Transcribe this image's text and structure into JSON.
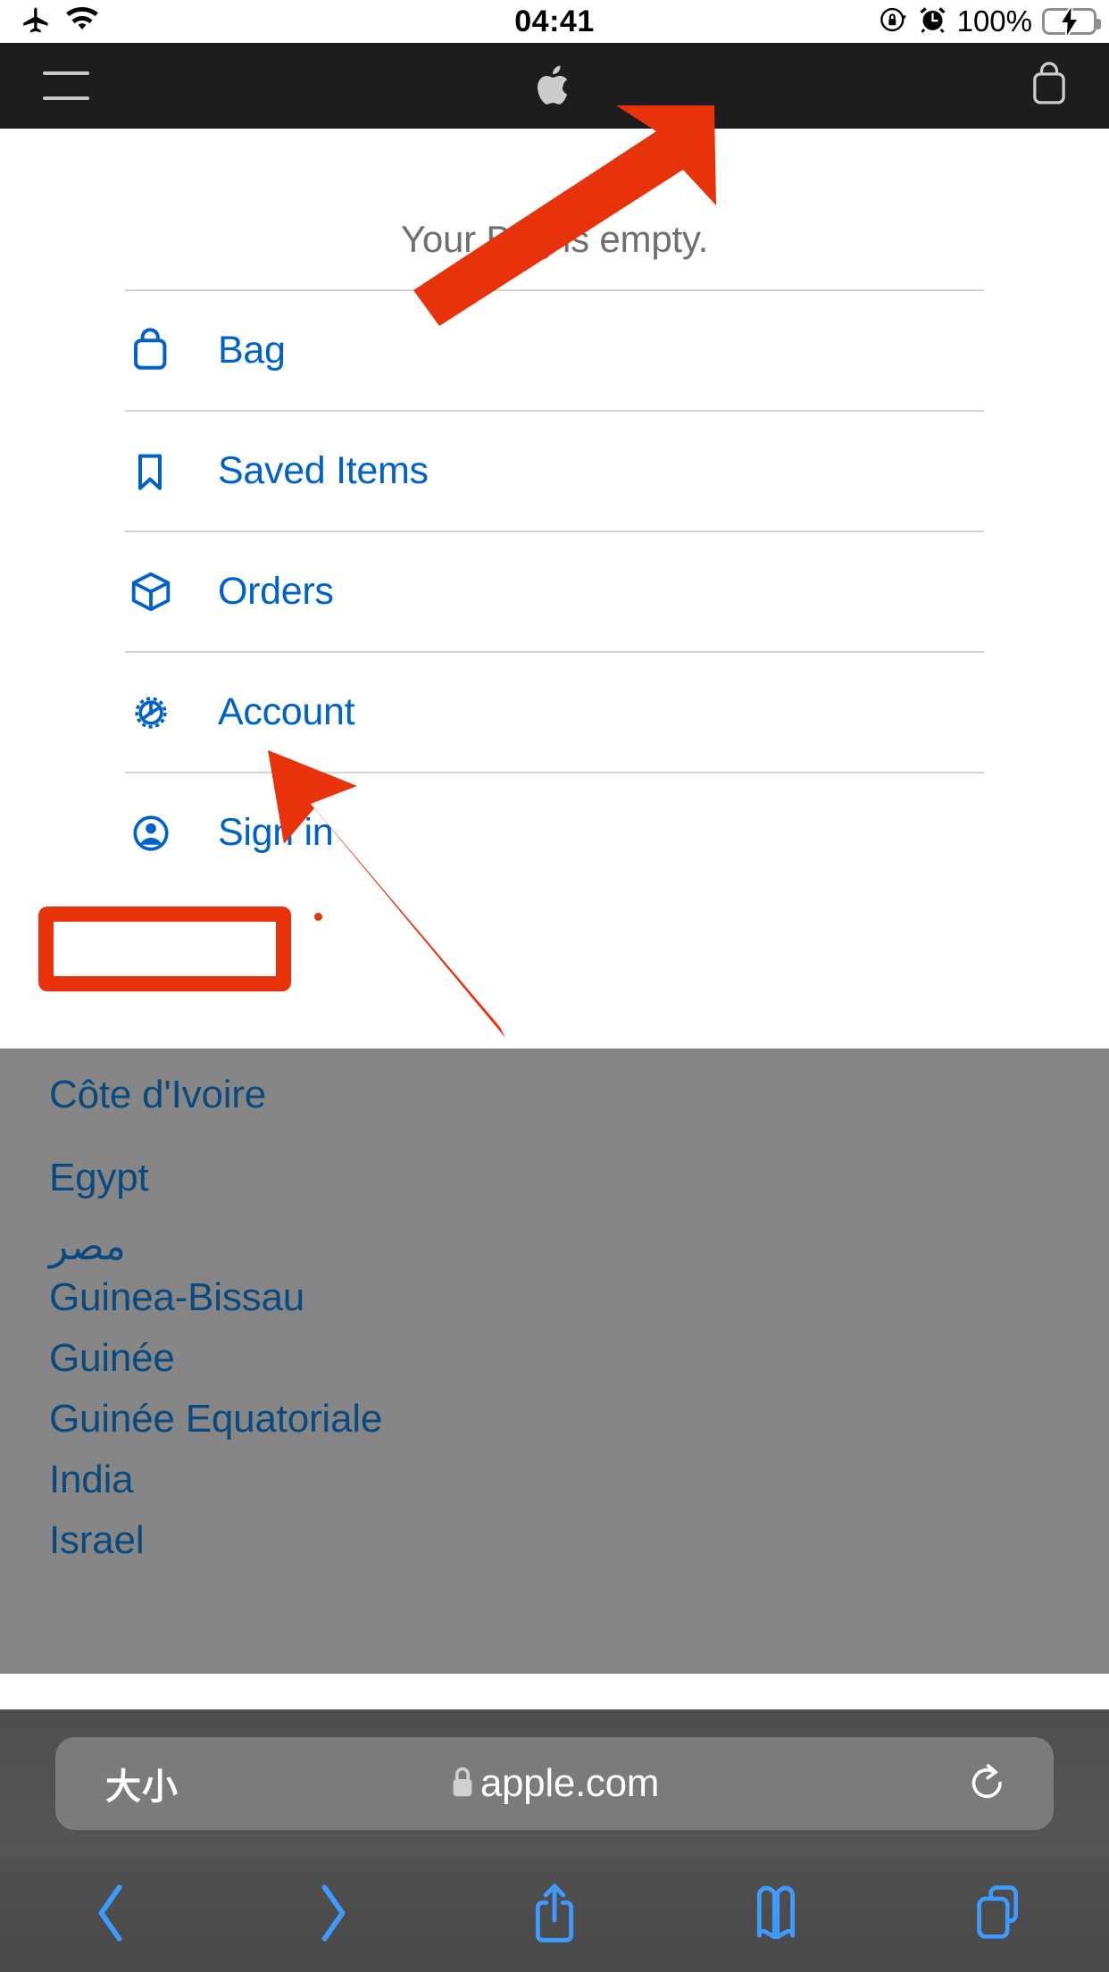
{
  "status_bar": {
    "airplane_icon": "airplane-mode-icon",
    "wifi_icon": "wifi-icon",
    "time": "04:41",
    "rotation_lock_icon": "rotation-lock-icon",
    "alarm_icon": "alarm-clock-icon",
    "battery_percent": "100%",
    "battery_icon": "battery-charging-icon",
    "battery_color": "#35c759"
  },
  "nav_bar": {
    "menu_icon": "hamburger-menu-icon",
    "logo_icon": "apple-logo-icon",
    "bag_icon": "shopping-bag-icon",
    "background": "#1d1d1f"
  },
  "bag_panel": {
    "empty_message": "Your Bag is empty.",
    "link_color": "#0062c7",
    "items": [
      {
        "label": "Bag",
        "icon": "bag-icon"
      },
      {
        "label": "Saved Items",
        "icon": "bookmark-icon"
      },
      {
        "label": "Orders",
        "icon": "box-icon"
      },
      {
        "label": "Account",
        "icon": "gear-icon"
      },
      {
        "label": "Sign in",
        "icon": "person-circle-icon"
      }
    ]
  },
  "country_list": {
    "text_color": "#0b4a7f",
    "background": "#868686",
    "items": [
      "Côte d'Ivoire",
      "Egypt",
      "مصر",
      "Guinea-Bissau",
      "Guinée",
      "Guinée Equatoriale",
      "India",
      "Israel"
    ]
  },
  "safari": {
    "text_size_label": "大小",
    "lock_icon": "lock-icon",
    "url": "apple.com",
    "reload_icon": "reload-icon",
    "toolbar": [
      {
        "name": "back",
        "icon": "chevron-left-icon"
      },
      {
        "name": "forward",
        "icon": "chevron-right-icon"
      },
      {
        "name": "share",
        "icon": "share-icon"
      },
      {
        "name": "bookmarks",
        "icon": "book-icon"
      },
      {
        "name": "tabs",
        "icon": "tabs-icon"
      }
    ],
    "tint_color": "#3e9bfd"
  },
  "annotations": {
    "highlight_color": "#e8320c",
    "highlight_target": "Sign in",
    "arrows": 2
  }
}
